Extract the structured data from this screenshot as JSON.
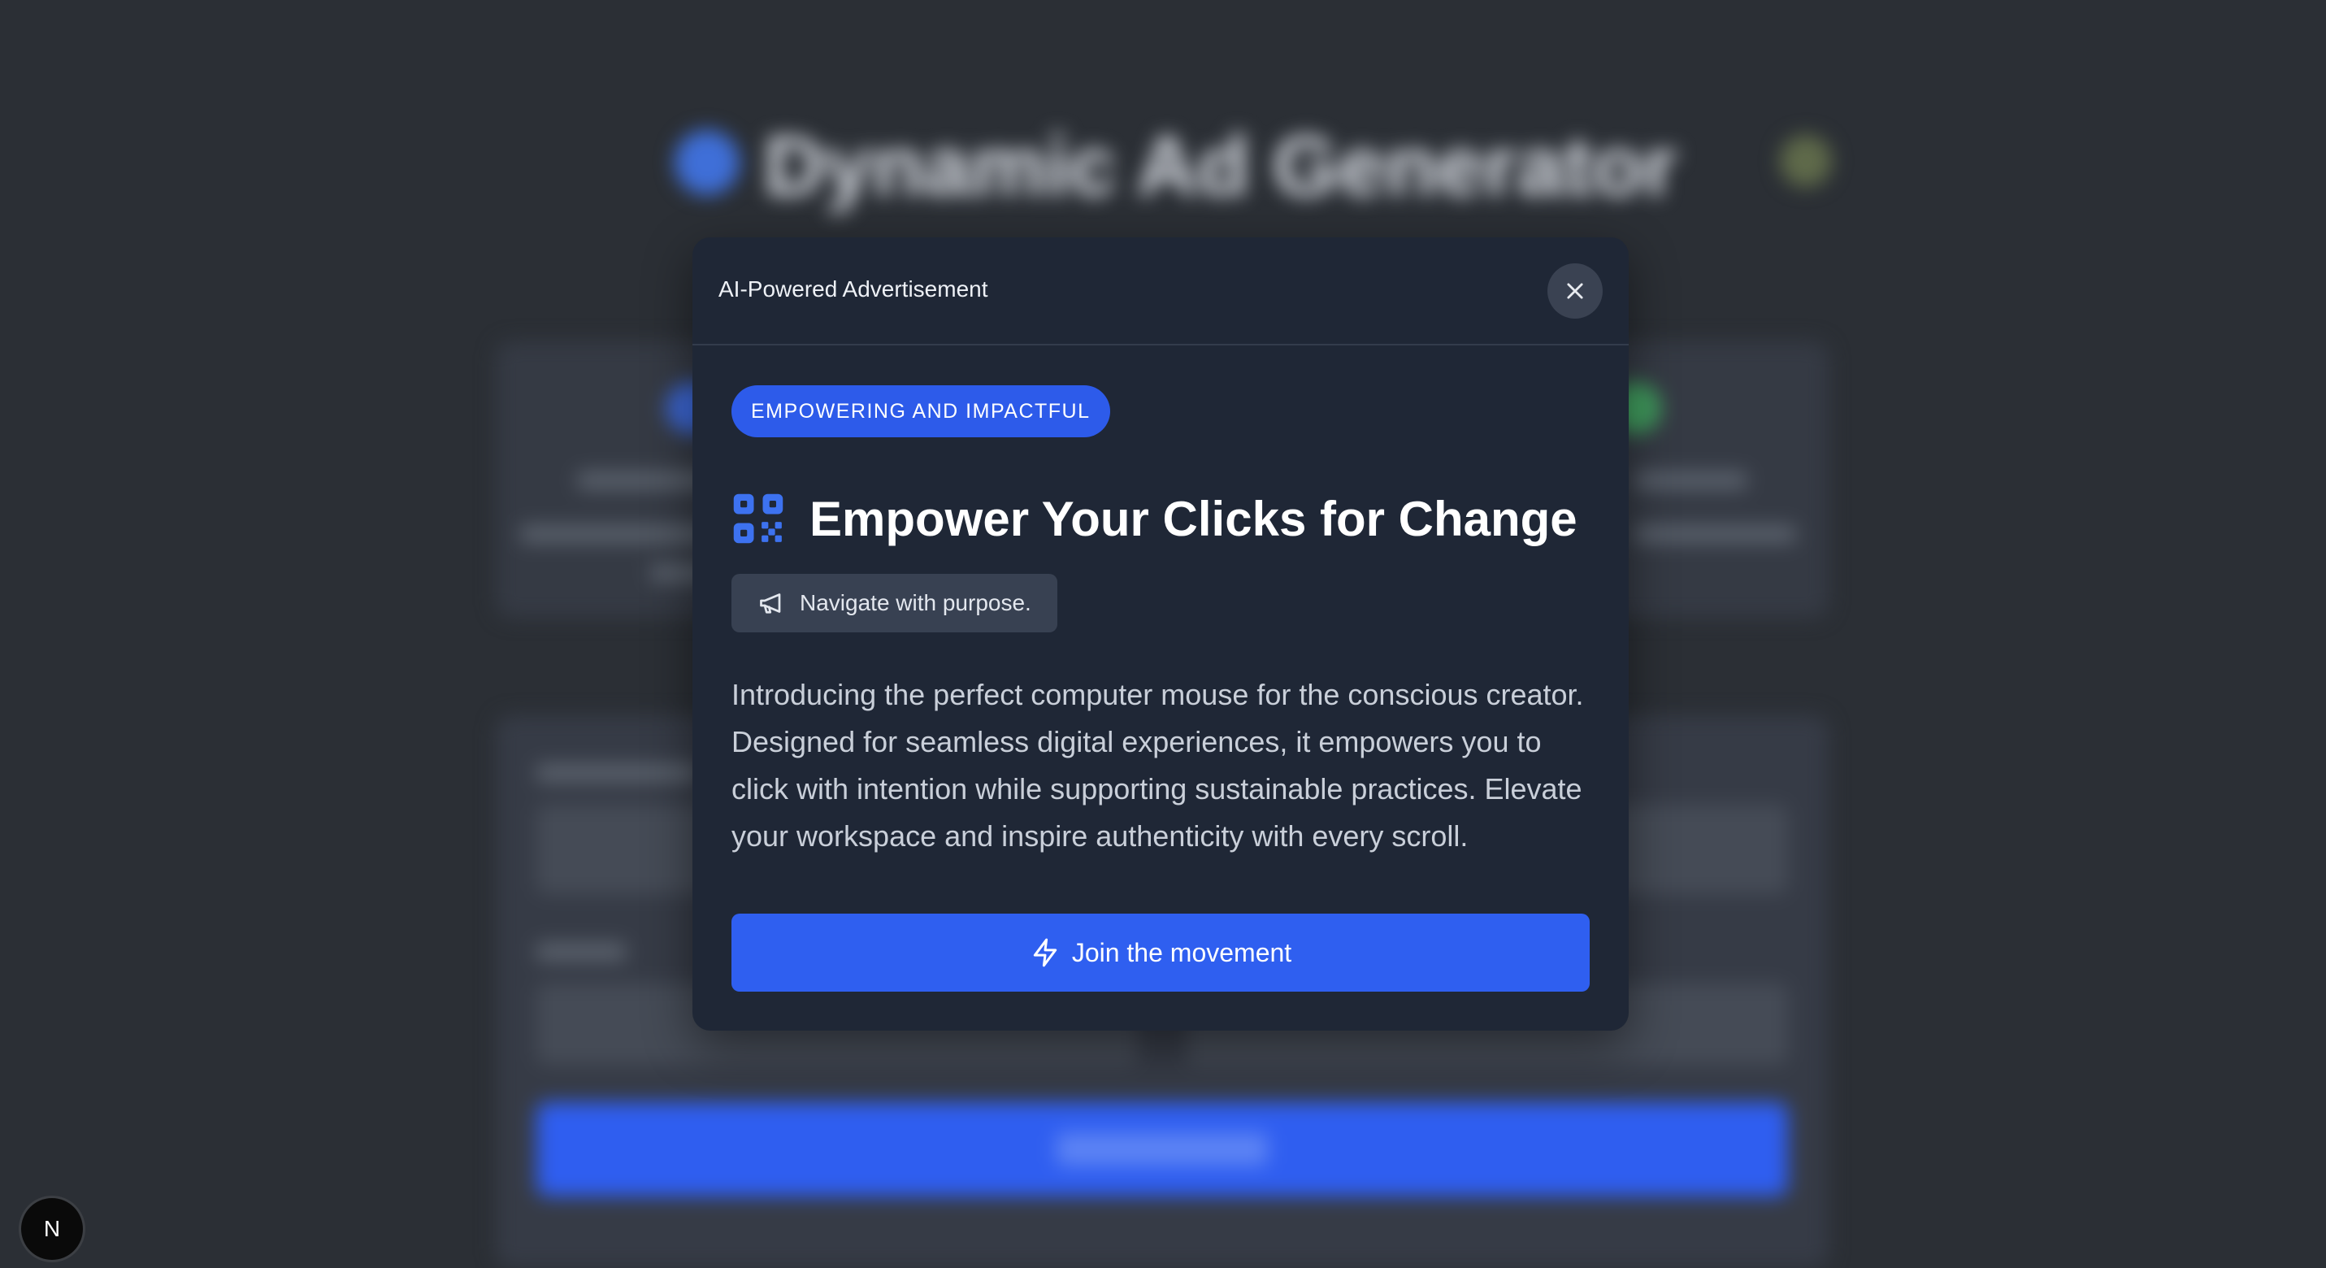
{
  "background_page": {
    "title": "Dynamic Ad Generator"
  },
  "modal": {
    "header_title": "AI-Powered Advertisement",
    "close_icon": "close-icon",
    "tag": "EMPOWERING AND IMPACTFUL",
    "headline_icon": "qr-code-icon",
    "headline": "Empower Your Clicks for Change",
    "tagline_icon": "megaphone-icon",
    "tagline": "Navigate with purpose.",
    "body": "Introducing the perfect computer mouse for the conscious creator. Designed for seamless digital experiences, it empowers you to click with intention while supporting sustainable practices. Elevate your workspace and inspire authenticity with every scroll.",
    "cta_icon": "lightning-icon",
    "cta_label": "Join the movement"
  },
  "dev_badge": {
    "letter": "N",
    "icon": "nextjs-logo-icon"
  },
  "colors": {
    "accent": "#2f5ff0",
    "modal_bg": "#1f2736",
    "overlay_bg": "#2b2f35",
    "chip_bg": "#384152"
  }
}
